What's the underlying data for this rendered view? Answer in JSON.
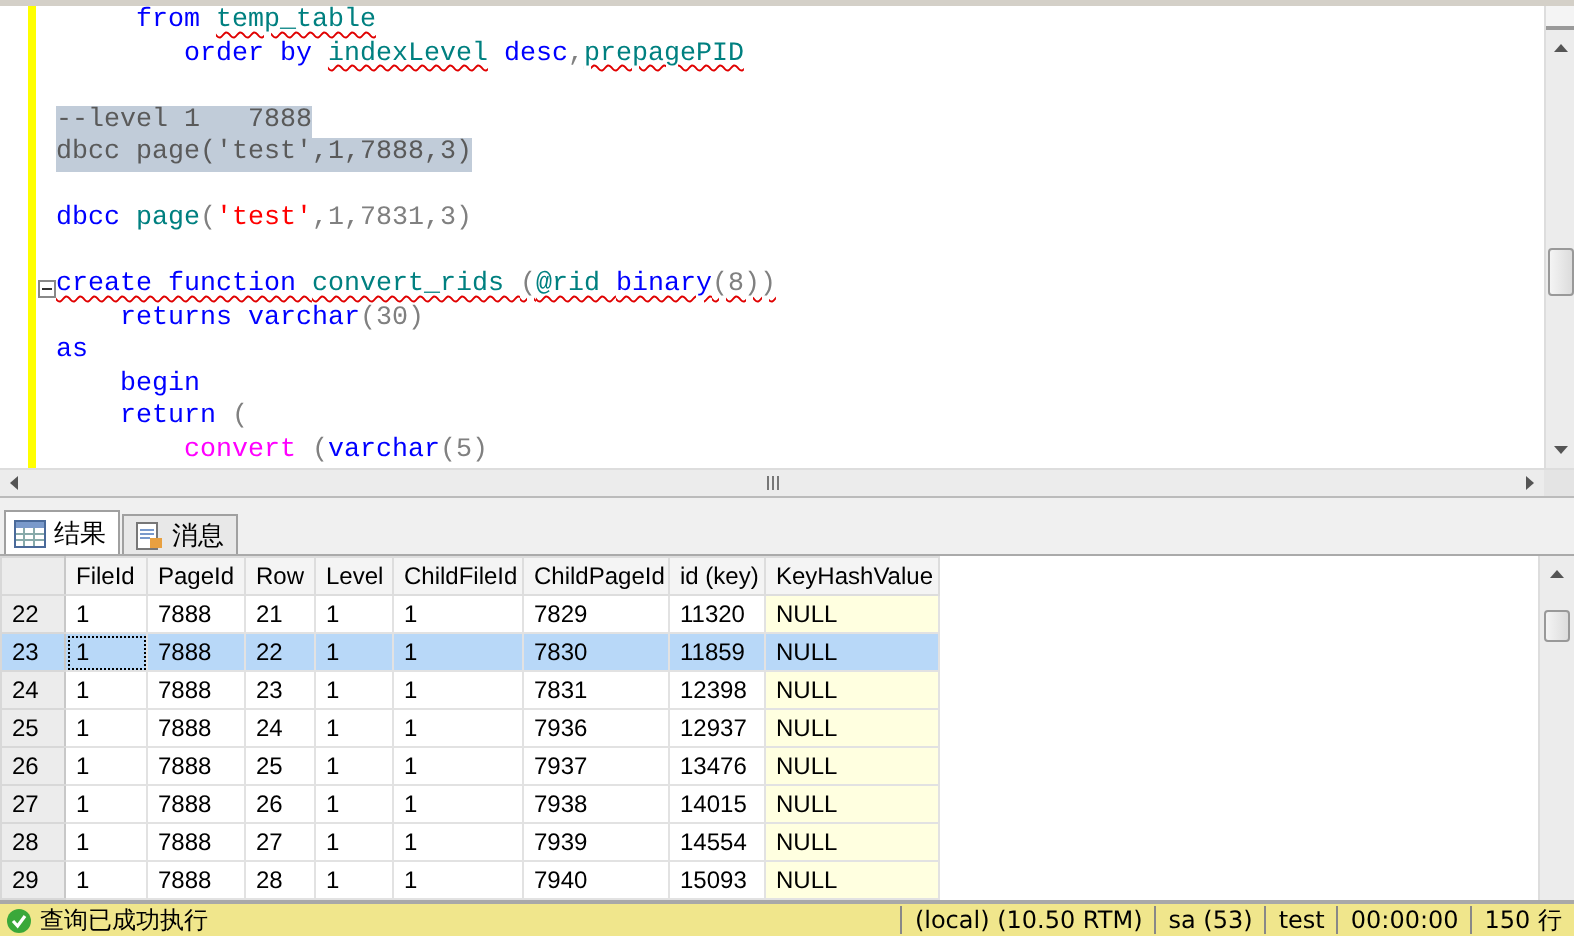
{
  "editor": {
    "lines": [
      {
        "selected": false,
        "tokens": [
          {
            "kind": "keyword",
            "text": "     from "
          },
          {
            "kind": "identifier",
            "text": "temp_table",
            "error": true
          }
        ]
      },
      {
        "selected": false,
        "tokens": [
          {
            "kind": "keyword",
            "text": "        order by "
          },
          {
            "kind": "identifier",
            "text": "indexLevel",
            "error": true
          },
          {
            "kind": "keyword",
            "text": " desc"
          },
          {
            "kind": "punct",
            "text": ","
          },
          {
            "kind": "identifier",
            "text": "prepagePID",
            "error": true
          }
        ]
      },
      {
        "selected": false
      },
      {
        "selected": true,
        "tokens": [
          {
            "kind": "comment",
            "text": "--level 1   7888"
          }
        ]
      },
      {
        "selected": true,
        "tokens": [
          {
            "kind": "comment",
            "text": "dbcc page('test',1,7888,3)"
          }
        ]
      },
      {
        "selected": false
      },
      {
        "selected": false,
        "tokens": [
          {
            "kind": "keyword",
            "text": "dbcc "
          },
          {
            "kind": "identifier",
            "text": "page"
          },
          {
            "kind": "punct",
            "text": "("
          },
          {
            "kind": "string",
            "text": "'test'"
          },
          {
            "kind": "punct",
            "text": ",1,7831,3)"
          }
        ]
      },
      {
        "selected": false
      },
      {
        "selected": false,
        "fold": true,
        "error": true,
        "tokens": [
          {
            "kind": "keyword",
            "text": "create function "
          },
          {
            "kind": "identifier",
            "text": "convert_rids "
          },
          {
            "kind": "punct",
            "text": "("
          },
          {
            "kind": "identifier",
            "text": "@rid "
          },
          {
            "kind": "keyword",
            "text": "binary"
          },
          {
            "kind": "punct",
            "text": "(8))"
          }
        ]
      },
      {
        "selected": false,
        "tokens": [
          {
            "kind": "keyword",
            "text": "    returns varchar"
          },
          {
            "kind": "punct",
            "text": "(30)"
          }
        ]
      },
      {
        "selected": false,
        "tokens": [
          {
            "kind": "keyword",
            "text": "as"
          }
        ]
      },
      {
        "selected": false,
        "tokens": [
          {
            "kind": "keyword",
            "text": "    begin"
          }
        ]
      },
      {
        "selected": false,
        "tokens": [
          {
            "kind": "keyword",
            "text": "    return "
          },
          {
            "kind": "punct",
            "text": "("
          }
        ]
      },
      {
        "selected": false,
        "tokens": [
          {
            "kind": "function",
            "text": "        convert "
          },
          {
            "kind": "punct",
            "text": "("
          },
          {
            "kind": "keyword",
            "text": "varchar"
          },
          {
            "kind": "punct",
            "text": "(5)"
          }
        ]
      }
    ]
  },
  "tabs": [
    {
      "label": "结果",
      "selected": true
    },
    {
      "label": "消息",
      "selected": false
    }
  ],
  "results": {
    "columns": [
      "FileId",
      "PageId",
      "Row",
      "Level",
      "ChildFileId",
      "ChildPageId",
      "id (key)",
      "KeyHashValue"
    ],
    "rows": [
      {
        "number": "22",
        "selected": false,
        "focused": false,
        "cells": [
          "1",
          "7888",
          "21",
          "1",
          "1",
          "7829",
          "11320",
          "NULL"
        ]
      },
      {
        "number": "23",
        "selected": true,
        "focused": true,
        "cells": [
          "1",
          "7888",
          "22",
          "1",
          "1",
          "7830",
          "11859",
          "NULL"
        ]
      },
      {
        "number": "24",
        "selected": false,
        "focused": false,
        "cells": [
          "1",
          "7888",
          "23",
          "1",
          "1",
          "7831",
          "12398",
          "NULL"
        ]
      },
      {
        "number": "25",
        "selected": false,
        "focused": false,
        "cells": [
          "1",
          "7888",
          "24",
          "1",
          "1",
          "7936",
          "12937",
          "NULL"
        ]
      },
      {
        "number": "26",
        "selected": false,
        "focused": false,
        "cells": [
          "1",
          "7888",
          "25",
          "1",
          "1",
          "7937",
          "13476",
          "NULL"
        ]
      },
      {
        "number": "27",
        "selected": false,
        "focused": false,
        "cells": [
          "1",
          "7888",
          "26",
          "1",
          "1",
          "7938",
          "14015",
          "NULL"
        ]
      },
      {
        "number": "28",
        "selected": false,
        "focused": false,
        "cells": [
          "1",
          "7888",
          "27",
          "1",
          "1",
          "7939",
          "14554",
          "NULL"
        ]
      },
      {
        "number": "29",
        "selected": false,
        "focused": false,
        "cells": [
          "1",
          "7888",
          "28",
          "1",
          "1",
          "7940",
          "15093",
          "NULL"
        ]
      }
    ]
  },
  "status_bar": {
    "message": "查询已成功执行",
    "items": [
      "(local) (10.50 RTM)",
      "sa (53)",
      "test",
      "00:00:00",
      "150 行"
    ]
  }
}
